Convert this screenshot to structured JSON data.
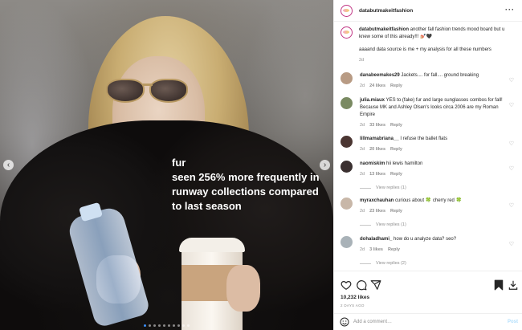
{
  "header": {
    "username": "databutmakeitfashion",
    "more_icon": "more-horizontal-icon"
  },
  "media": {
    "overlay_text": "fur\nseen 256% more frequently in runway collections compared to last season",
    "slide_count": 10,
    "active_slide": 1
  },
  "caption": {
    "username": "databutmakeitfashion",
    "text": "another fall fashion trends mood board but u knew some of this already!!! 💅🏼🖤",
    "text2": "aaaand data source is me + my analysis for all these numbers",
    "time": "2d"
  },
  "comments": [
    {
      "username": "danabeemakes29",
      "text": "Jackets.... for fall.... ground breaking",
      "time": "2d",
      "likes": "24 likes",
      "reply": "Reply",
      "avatar_color": "#b89b84",
      "view_replies": ""
    },
    {
      "username": "julia.miaux",
      "text": "YES to (fake) fur and large sunglasses combos for fall! Because MK and Ashley Olsen's looks circa 2006 are my Roman Empire",
      "time": "2d",
      "likes": "33 likes",
      "reply": "Reply",
      "avatar_color": "#7a8a62",
      "view_replies": ""
    },
    {
      "username": "lillmamabriana__",
      "text": "I refuse the ballet flats",
      "time": "2d",
      "likes": "20 likes",
      "reply": "Reply",
      "avatar_color": "#4b3632",
      "view_replies": ""
    },
    {
      "username": "naomiskim",
      "text": "hii lewis hamilton",
      "time": "2d",
      "likes": "13 likes",
      "reply": "Reply",
      "avatar_color": "#3a3030",
      "view_replies": "View replies (1)"
    },
    {
      "username": "myraxchauhan",
      "text": "curious about 🍀 cherry red 🍀",
      "time": "2d",
      "likes": "23 likes",
      "reply": "Reply",
      "avatar_color": "#c8b7a8",
      "view_replies": "View replies (1)"
    },
    {
      "username": "dohaladhami_",
      "text": "how do u analyze data? seo?",
      "time": "2d",
      "likes": "3 likes",
      "reply": "Reply",
      "avatar_color": "#a9b2b8",
      "view_replies": "View replies (2)"
    }
  ],
  "actions": {
    "likes": "10,232 likes",
    "when": "2 DAYS AGO"
  },
  "add_comment": {
    "placeholder": "Add a comment…",
    "post_label": "Post",
    "emoji_icon": "smiley-icon"
  },
  "colors": {
    "accent": "#0095f6",
    "muted": "#8e8e8e",
    "post_disabled": "#b2dffc"
  }
}
